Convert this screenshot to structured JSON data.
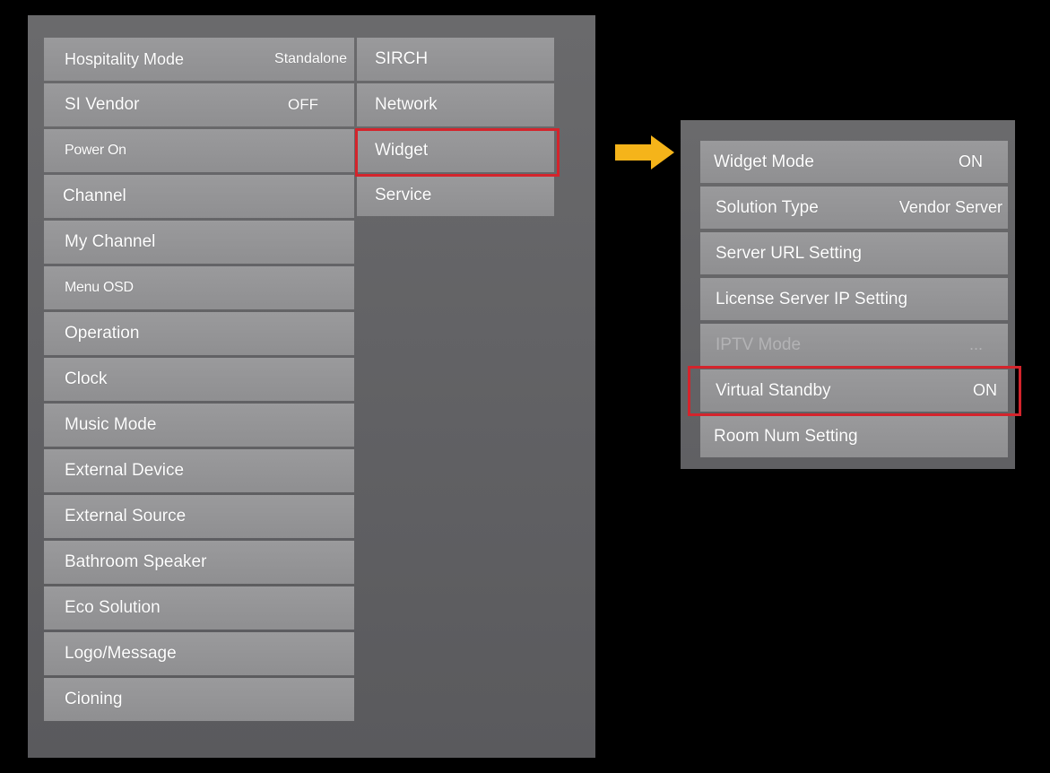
{
  "main_menu": {
    "left_items": [
      {
        "label": "Hospitality Mode",
        "value": "Standalone"
      },
      {
        "label": "SI Vendor",
        "value": "OFF"
      },
      {
        "label": "Power On",
        "value": ""
      },
      {
        "label": "Channel",
        "value": ""
      },
      {
        "label": "My Channel",
        "value": ""
      },
      {
        "label": "Menu OSD",
        "value": ""
      },
      {
        "label": "Operation",
        "value": ""
      },
      {
        "label": "Clock",
        "value": ""
      },
      {
        "label": "Music Mode",
        "value": ""
      },
      {
        "label": "External Device",
        "value": ""
      },
      {
        "label": "External Source",
        "value": ""
      },
      {
        "label": "Bathroom Speaker",
        "value": ""
      },
      {
        "label": "Eco Solution",
        "value": ""
      },
      {
        "label": "Logo/Message",
        "value": ""
      },
      {
        "label": "Cioning",
        "value": ""
      }
    ],
    "right_items": [
      {
        "label": "SIRCH"
      },
      {
        "label": "Network"
      },
      {
        "label": "Widget"
      },
      {
        "label": "Service"
      }
    ],
    "highlighted_item": "Widget"
  },
  "arrow": {
    "icon": "right-arrow-icon",
    "color": "#f5b41a"
  },
  "submenu": {
    "items": [
      {
        "label": "Widget Mode",
        "value": "ON"
      },
      {
        "label": "Solution Type",
        "value": "Vendor Server"
      },
      {
        "label": "Server URL Setting",
        "value": ""
      },
      {
        "label": "License Server IP Setting",
        "value": ""
      },
      {
        "label": "IPTV Mode",
        "value": "...",
        "disabled": true
      },
      {
        "label": "Virtual Standby",
        "value": "ON"
      },
      {
        "label": "Room Num Setting",
        "value": ""
      }
    ],
    "highlighted_item": "Virtual Standby"
  },
  "colors": {
    "highlight": "#d4242c",
    "item_bg": "#949496",
    "panel_bg": "#646467",
    "background": "#000000"
  }
}
